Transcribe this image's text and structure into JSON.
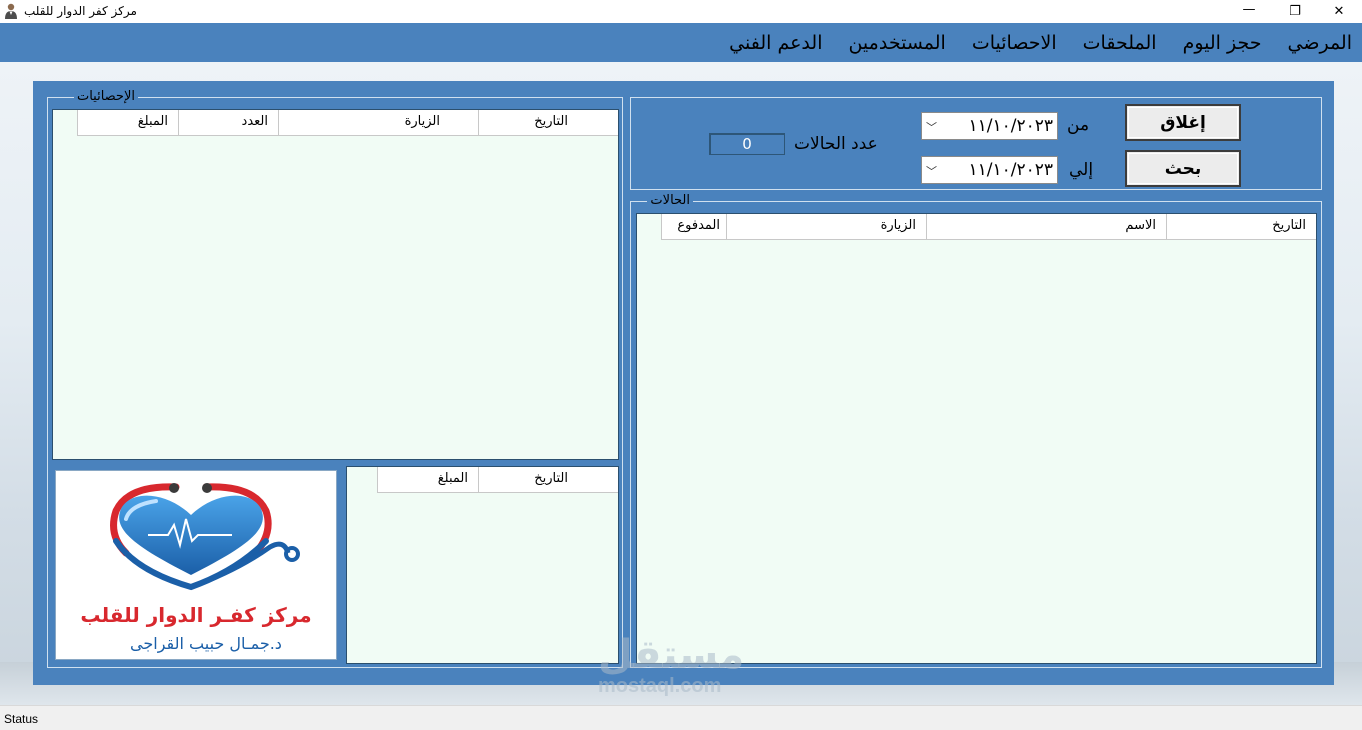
{
  "window": {
    "title": "مركز كفر الدوار للقلب",
    "restore_glyph": "❐",
    "close_glyph": "✕"
  },
  "menu": [
    "المرضي",
    "حجز اليوم",
    "الملحقات",
    "الاحصائيات",
    "المستخدمين",
    "الدعم الفني"
  ],
  "search_panel": {
    "close_button": "إغلاق",
    "search_button": "بحث",
    "from_label": "من",
    "to_label": "إلي",
    "from_date": "١١/١٠/٢٠٢٣",
    "to_date": "١١/١٠/٢٠٢٣",
    "cases_count_label": "عدد الحالات",
    "cases_count_value": "0"
  },
  "cases_group": {
    "label": "الحالات",
    "columns": [
      "التاريخ",
      "الاسم",
      "الزيارة",
      "المدفوع"
    ]
  },
  "stats_group": {
    "label": "الإحصائيات",
    "columns": [
      "التاريخ",
      "الزيارة",
      "العدد",
      "المبلغ"
    ],
    "small_table_columns": [
      "التاريخ",
      "المبلغ"
    ]
  },
  "logo": {
    "line1": "مركز كفـر الدوار للقلب",
    "line2": "د.جمـال حبيب القراجى"
  },
  "watermark": {
    "arabic": "مستقل",
    "latin": "mostaql.com"
  },
  "status": "Status"
}
